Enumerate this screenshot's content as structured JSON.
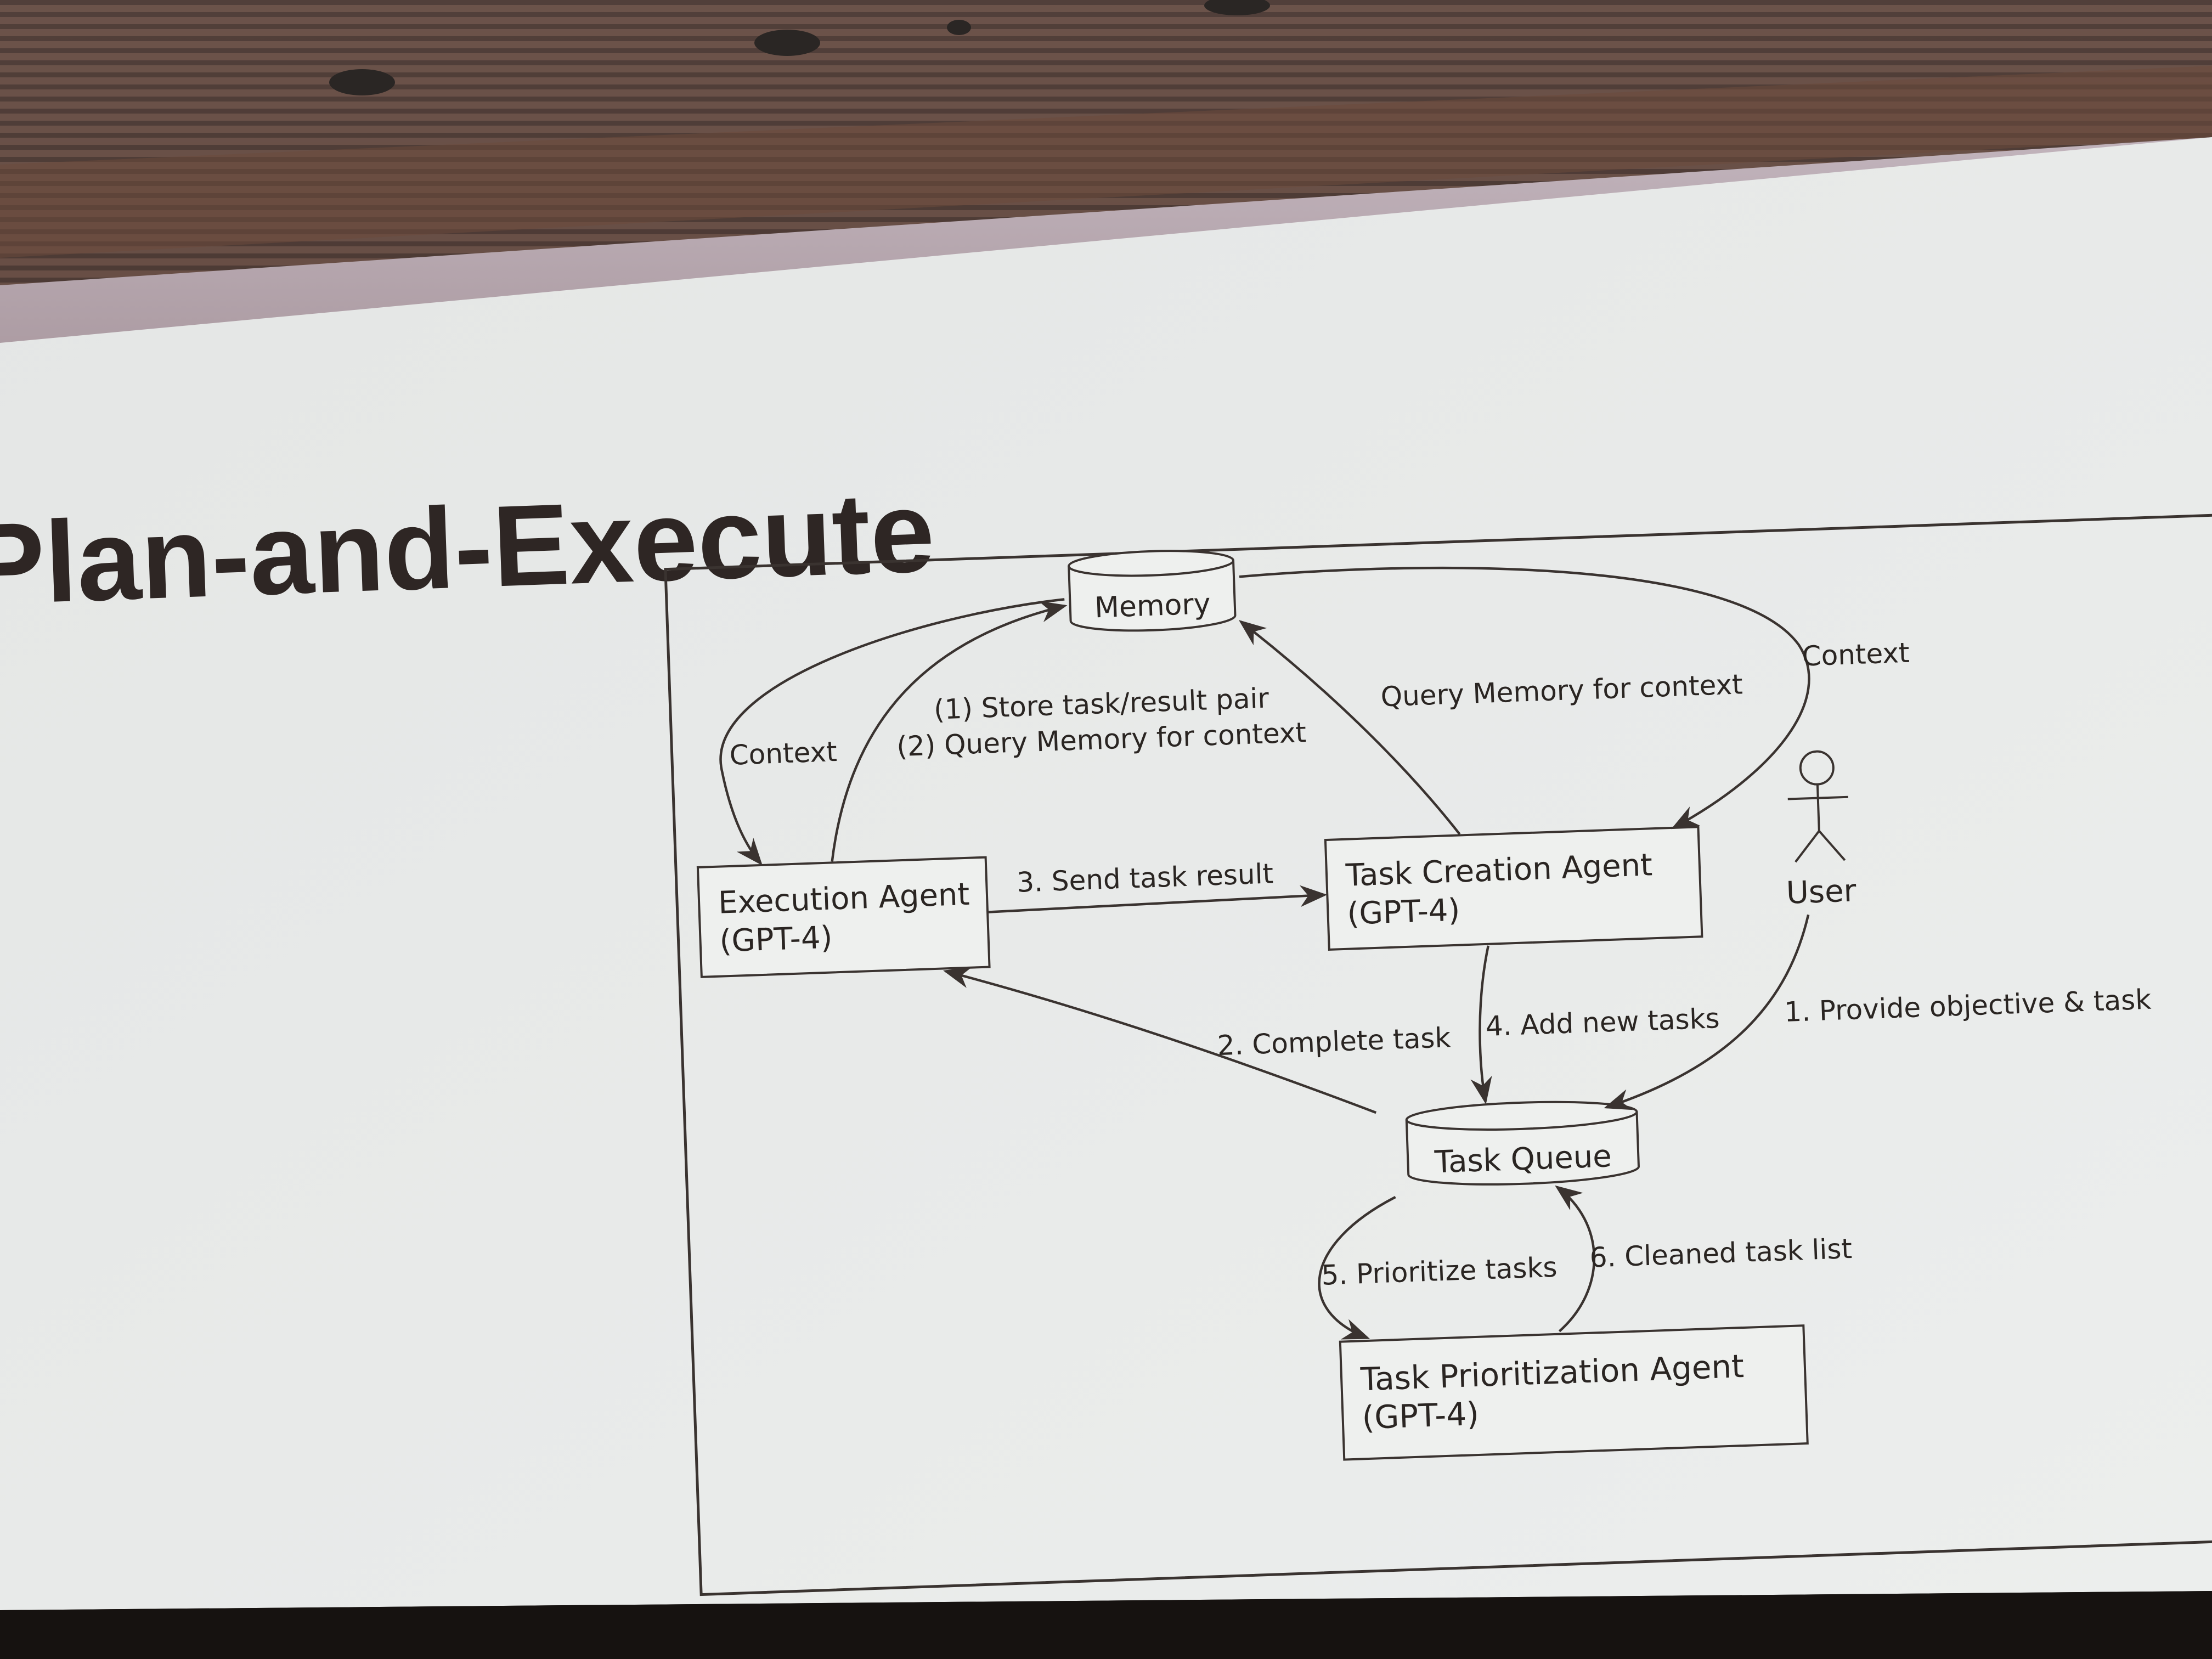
{
  "slide": {
    "title": "Plan-and-Execute"
  },
  "diagram": {
    "nodes": {
      "memory": "Memory",
      "execution_agent": [
        "Execution Agent",
        "(GPT-4)"
      ],
      "task_creation_agent": [
        "Task Creation Agent",
        "(GPT-4)"
      ],
      "task_queue": "Task Queue",
      "task_prioritization_agent": [
        "Task Prioritization Agent",
        "(GPT-4)"
      ],
      "user": "User"
    },
    "edges": {
      "memory_to_execution": "Context",
      "execution_to_memory_1": "(1) Store task/result pair",
      "execution_to_memory_2": "(2) Query Memory for context",
      "creation_to_memory": "Query Memory for context",
      "memory_to_creation": "Context",
      "execution_to_creation": "3. Send task result",
      "queue_to_execution": "2. Complete task",
      "creation_to_queue": "4. Add new tasks",
      "user_to_queue": "1. Provide objective & task",
      "queue_to_prioritization": "5. Prioritize tasks",
      "prioritization_to_queue": "6. Cleaned task list"
    }
  }
}
